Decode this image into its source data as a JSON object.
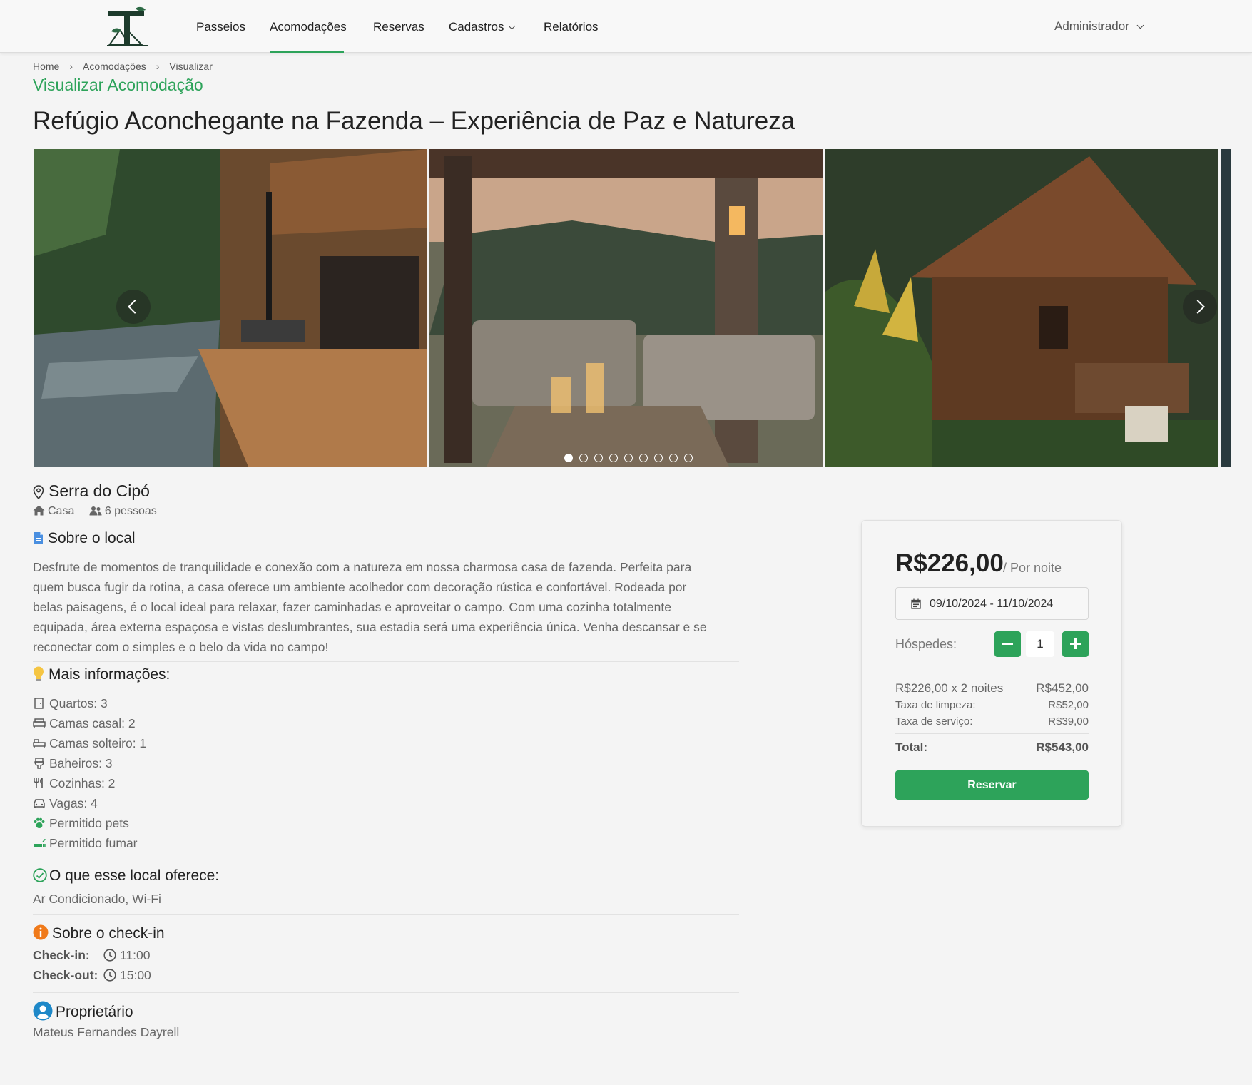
{
  "nav": {
    "items": [
      "Passeios",
      "Acomodações",
      "Reservas",
      "Cadastros",
      "Relatórios"
    ],
    "active": "Acomodações",
    "user": "Administrador"
  },
  "breadcrumb": [
    "Home",
    "Acomodações",
    "Visualizar"
  ],
  "page": {
    "subtitle": "Visualizar Acomodação",
    "title": "Refúgio Aconchegante na Fazenda – Experiência de Paz e Natureza"
  },
  "carousel": {
    "slide_count": 9,
    "active_index": 0
  },
  "location": "Serra do Cipó",
  "property_type": "Casa",
  "capacity": "6 pessoas",
  "about": {
    "heading": "Sobre o local",
    "lines": [
      "Desfrute de momentos de tranquilidade e conexão com a natureza em nossa charmosa casa de fazenda. Perfeita para",
      "quem busca fugir da rotina, a casa oferece um ambiente acolhedor com decoração rústica e confortável. Rodeada por",
      "belas paisagens, é o local ideal para relaxar, fazer caminhadas e aproveitar o campo. Com uma cozinha totalmente",
      "equipada, área externa espaçosa e vistas deslumbrantes, sua estadia será uma experiência única. Venha descansar e se",
      "reconectar com o simples e o belo da vida no campo!"
    ]
  },
  "more_info": {
    "heading": "Mais informações:",
    "items": [
      {
        "text": "Quartos: 3",
        "icon": "door-icon"
      },
      {
        "text": "Camas casal: 2",
        "icon": "double-bed-icon"
      },
      {
        "text": "Camas solteiro: 1",
        "icon": "single-bed-icon"
      },
      {
        "text": "Baheiros: 3",
        "icon": "toilet-icon"
      },
      {
        "text": "Cozinhas: 2",
        "icon": "utensils-icon"
      },
      {
        "text": "Vagas: 4",
        "icon": "car-icon"
      },
      {
        "text": "Permitido pets",
        "icon": "paw-icon"
      },
      {
        "text": "Permitido fumar",
        "icon": "smoking-icon"
      }
    ]
  },
  "amenities": {
    "heading": "O que esse local oferece:",
    "text": "Ar Condicionado, Wi-Fi"
  },
  "checkin": {
    "heading": "Sobre o check-in",
    "checkin_label": "Check-in:",
    "checkin_time": "11:00",
    "checkout_label": "Check-out:",
    "checkout_time": "15:00"
  },
  "owner": {
    "heading": "Proprietário",
    "name": "Mateus Fernandes Dayrell"
  },
  "booking": {
    "price": "R$226,00",
    "per_night": "/ Por noite",
    "dates": "09/10/2024 - 11/10/2024",
    "guests_label": "Hóspedes:",
    "guests": "1",
    "nights_label": "R$226,00 x 2 noites",
    "nights_value": "R$452,00",
    "cleaning_label": "Taxa de limpeza:",
    "cleaning_value": "R$52,00",
    "service_label": "Taxa de serviço:",
    "service_value": "R$39,00",
    "total_label": "Total:",
    "total_value": "R$543,00",
    "reserve_label": "Reservar"
  },
  "colors": {
    "brand_green": "#2da35a",
    "background": "#f4f4f4"
  }
}
